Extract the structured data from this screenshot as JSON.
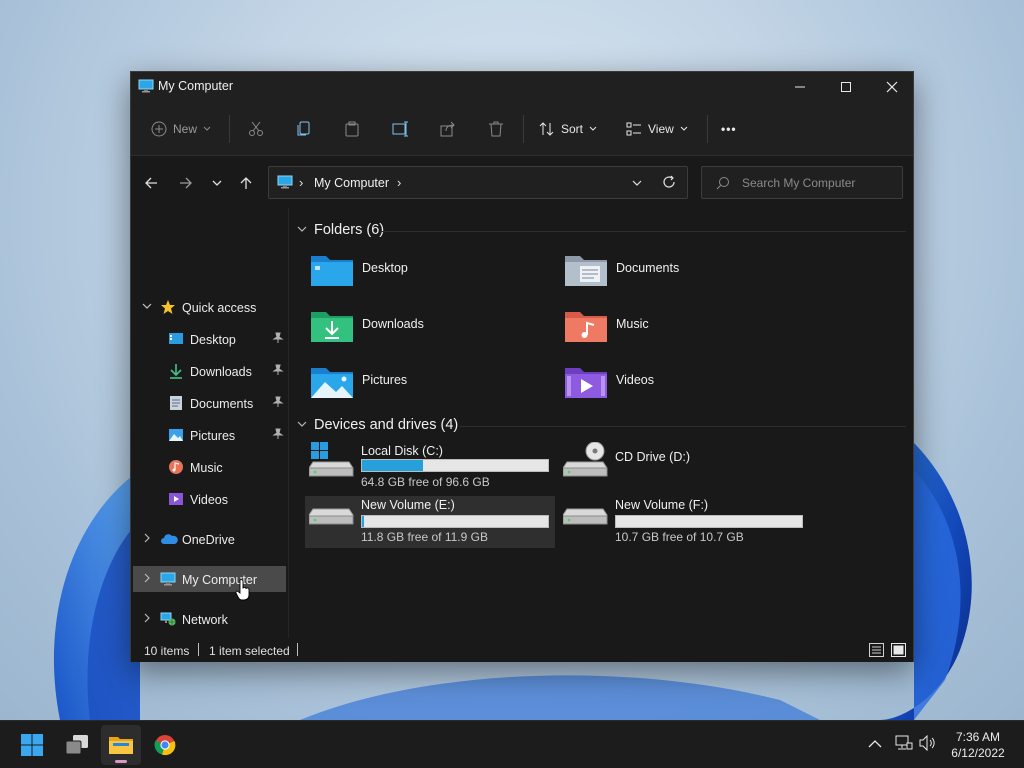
{
  "window": {
    "title": "My Computer",
    "controls": {
      "minimize": "minimize",
      "maximize": "maximize",
      "close": "close"
    }
  },
  "commandbar": {
    "new_label": "New",
    "sort_label": "Sort",
    "view_label": "View",
    "more_label": "•••"
  },
  "address": {
    "path_label": "My Computer",
    "separator": "›"
  },
  "search": {
    "placeholder": "Search My Computer"
  },
  "sidebar": {
    "quick_access": "Quick access",
    "items": [
      {
        "label": "Desktop",
        "icon": "desktop-icon",
        "pinned": true
      },
      {
        "label": "Downloads",
        "icon": "downloads-icon",
        "pinned": true
      },
      {
        "label": "Documents",
        "icon": "documents-icon",
        "pinned": true
      },
      {
        "label": "Pictures",
        "icon": "pictures-icon",
        "pinned": true
      },
      {
        "label": "Music",
        "icon": "music-icon",
        "pinned": false
      },
      {
        "label": "Videos",
        "icon": "videos-icon",
        "pinned": false
      }
    ],
    "onedrive": "OneDrive",
    "my_computer": "My Computer",
    "network": "Network"
  },
  "content": {
    "folders_header": "Folders (6)",
    "folders": [
      {
        "name": "Desktop",
        "icon": "desktop-folder-icon"
      },
      {
        "name": "Documents",
        "icon": "documents-folder-icon"
      },
      {
        "name": "Downloads",
        "icon": "downloads-folder-icon"
      },
      {
        "name": "Music",
        "icon": "music-folder-icon"
      },
      {
        "name": "Pictures",
        "icon": "pictures-folder-icon"
      },
      {
        "name": "Videos",
        "icon": "videos-folder-icon"
      }
    ],
    "drives_header": "Devices and drives (4)",
    "drives": [
      {
        "name": "Local Disk (C:)",
        "free": "64.8 GB free of 96.6 GB",
        "used_fraction": 0.33,
        "icon": "windows-drive-icon",
        "selected": false
      },
      {
        "name": "CD Drive (D:)",
        "free": "",
        "used_fraction": null,
        "icon": "cd-drive-icon",
        "selected": false
      },
      {
        "name": "New Volume (E:)",
        "free": "11.8 GB free of 11.9 GB",
        "used_fraction": 0.01,
        "icon": "drive-icon",
        "selected": true
      },
      {
        "name": "New Volume (F:)",
        "free": "10.7 GB free of 10.7 GB",
        "used_fraction": 0.0,
        "icon": "drive-icon",
        "selected": false
      }
    ]
  },
  "statusbar": {
    "items_count": "10 items",
    "selected_count": "1 item selected"
  },
  "taskbar": {
    "clock_time": "7:36 AM",
    "clock_date": "6/12/2022"
  },
  "colors": {
    "accent": "#26a0da",
    "window_bg": "#191919",
    "selection": "#4a4a4a",
    "taskbar": "#1c1c1c"
  }
}
